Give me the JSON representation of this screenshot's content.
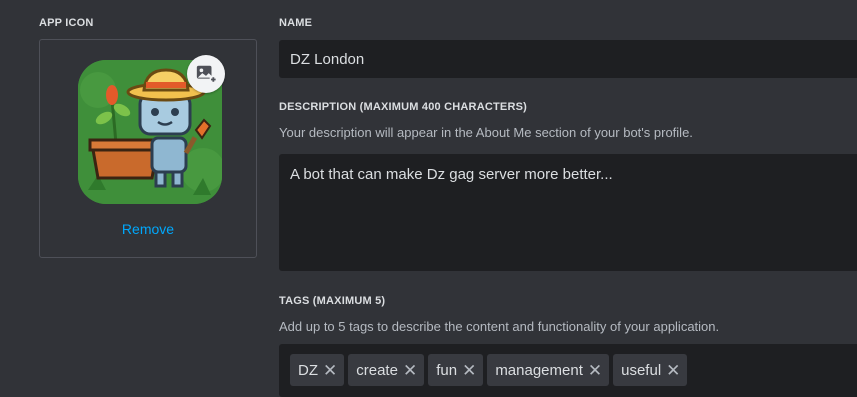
{
  "app_icon": {
    "label": "APP ICON",
    "remove_label": "Remove"
  },
  "name": {
    "label": "NAME",
    "value": "DZ London"
  },
  "description": {
    "label": "DESCRIPTION (MAXIMUM 400 CHARACTERS)",
    "helper": "Your description will appear in the About Me section of your bot's profile.",
    "value": "A bot that can make Dz gag server more better..."
  },
  "tags": {
    "label": "TAGS (MAXIMUM 5)",
    "helper": "Add up to 5 tags to describe the content and functionality of your application.",
    "items": [
      "DZ",
      "create",
      "fun",
      "management",
      "useful"
    ],
    "remove_glyph": "✕"
  },
  "colors": {
    "background": "#313338",
    "input_background": "#1e1f22",
    "tag_background": "#383a40",
    "link": "#00a8fc",
    "icon_green": "#3f8f3a"
  },
  "icons": [
    "image-plus-icon",
    "robot-gardener-app-icon",
    "close-icon"
  ]
}
